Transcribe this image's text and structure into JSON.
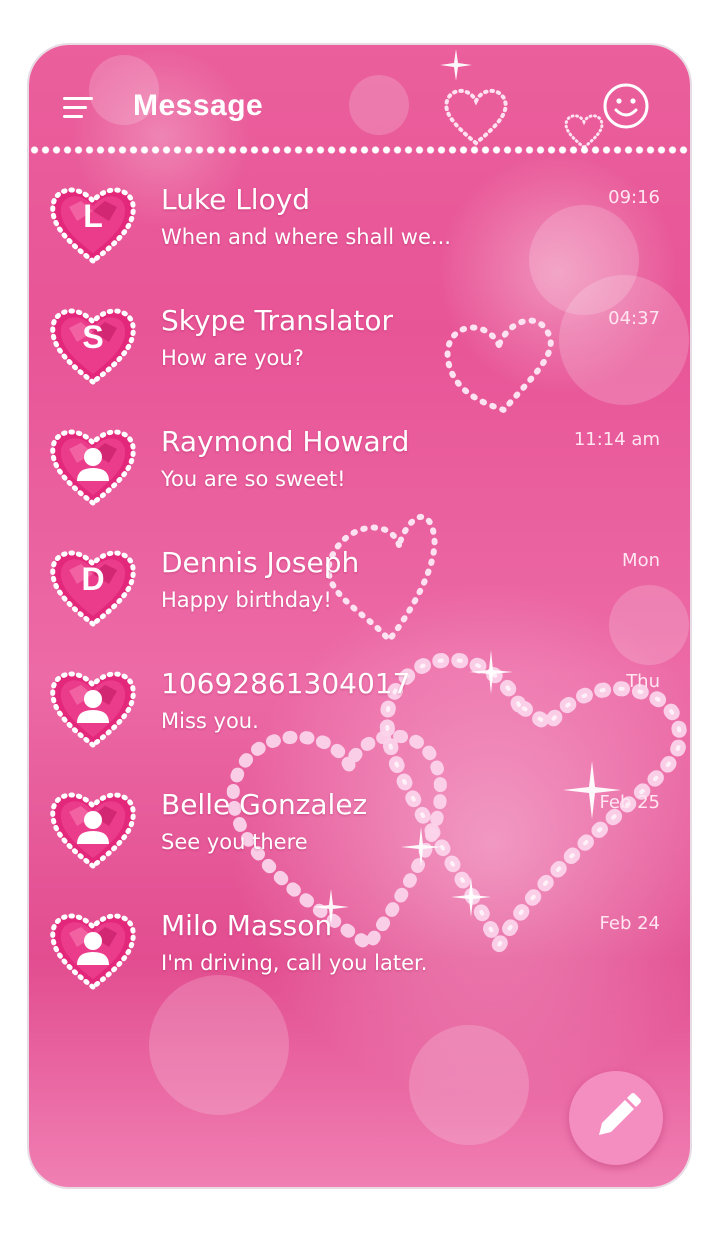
{
  "header": {
    "title": "Message",
    "menu_icon": "menu-icon",
    "emoji_icon": "smile-icon"
  },
  "conversations": [
    {
      "avatar_letter": "L",
      "avatar_type": "letter",
      "name": "Luke Lloyd",
      "snippet": "When and where shall we...",
      "time": "09:16"
    },
    {
      "avatar_letter": "S",
      "avatar_type": "letter",
      "name": "Skype Translator",
      "snippet": "How are you?",
      "time": "04:37"
    },
    {
      "avatar_letter": "",
      "avatar_type": "person",
      "name": "Raymond Howard",
      "snippet": "You are so sweet!",
      "time": "11:14 am"
    },
    {
      "avatar_letter": "D",
      "avatar_type": "letter",
      "name": "Dennis Joseph",
      "snippet": "Happy birthday!",
      "time": "Mon"
    },
    {
      "avatar_letter": "",
      "avatar_type": "person",
      "name": "10692861304017",
      "snippet": "Miss you.",
      "time": "Thu"
    },
    {
      "avatar_letter": "",
      "avatar_type": "person",
      "name": "Belle Gonzalez",
      "snippet": "See you there",
      "time": "Feb 25"
    },
    {
      "avatar_letter": "",
      "avatar_type": "person",
      "name": "Milo Masson",
      "snippet": "I'm driving, call you later.",
      "time": "Feb 24"
    }
  ],
  "fab": {
    "icon": "pencil-icon"
  },
  "colors": {
    "background": "#e85597",
    "heart": "#e0257a",
    "fab": "#f58ec0",
    "text": "#ffffff"
  }
}
